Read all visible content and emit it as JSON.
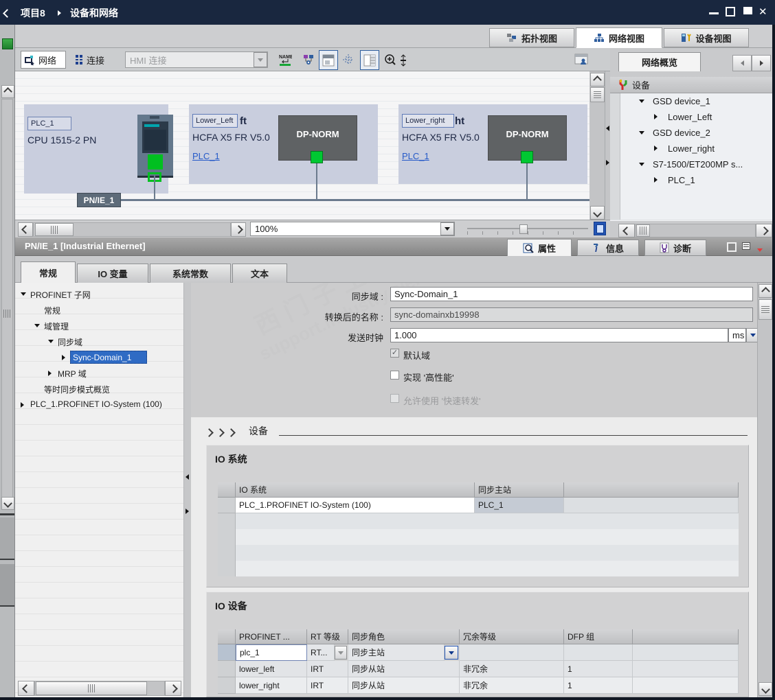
{
  "colors": {
    "titlebar_bg": "#19273f",
    "selection_blue": "#2f6bc4",
    "link_blue": "#2559c8",
    "status_green": "#00c832",
    "dpnorm_gray": "#5f6264",
    "device_lavender": "#c9cede",
    "bus_slate": "#6b7a8d"
  },
  "titlebar": {
    "project": "项目8",
    "page": "设备和网络"
  },
  "view_tabs": {
    "topology": "拓扑视图",
    "network": "网络视图",
    "device": "设备视图"
  },
  "toolbar": {
    "network": "网络",
    "connections": "连接",
    "hmi_connection": "HMI 连接"
  },
  "canvas": {
    "plc": {
      "name": "PLC_1",
      "model": "CPU 1515-2 PN"
    },
    "left": {
      "name": "Lower_Left",
      "tail": "ft",
      "model": "HCFA X5 FR V5.0",
      "link": "PLC_1",
      "badge": "DP-NORM"
    },
    "right": {
      "name": "Lower_right",
      "tail": "ht",
      "model": "HCFA X5 FR V5.0",
      "link": "PLC_1",
      "badge": "DP-NORM"
    },
    "bus": "PN/IE_1",
    "zoom": "100%"
  },
  "overview": {
    "tab": "网络概览",
    "device_col": "设备",
    "rows": [
      {
        "label": "GSD device_1"
      },
      {
        "label": "Lower_Left"
      },
      {
        "label": "GSD device_2"
      },
      {
        "label": "Lower_right"
      },
      {
        "label": "S7-1500/ET200MP s..."
      },
      {
        "label": "PLC_1"
      }
    ]
  },
  "props": {
    "title": "PN/IE_1 [Industrial Ethernet]",
    "tabs": {
      "properties": "属性",
      "info": "信息",
      "diagnostics": "诊断"
    },
    "subtabs": {
      "general": "常规",
      "io_tags": "IO 变量",
      "system_constants": "系统常数",
      "texts": "文本"
    },
    "tree": {
      "profinet_subnet": "PROFINET 子网",
      "general": "常规",
      "domain_management": "域管理",
      "sync_domain": "同步域",
      "sync_domain_1": "Sync-Domain_1",
      "mrp_domain": "MRP 域",
      "isochronous_overview": "等时同步模式概览",
      "io_system": "PLC_1.PROFINET IO-System (100)"
    },
    "form": {
      "sync_domain_label": "同步域 :",
      "sync_domain_value": "Sync-Domain_1",
      "converted_name_label": "转换后的名称 :",
      "converted_name_value": "sync-domainxb19998",
      "send_clock_label": "发送时钟",
      "send_clock_value": "1.000",
      "send_clock_unit": "ms",
      "default_domain_label": "默认域",
      "high_performance_label": "实现 '高性能'",
      "fast_forwarding_label": "允许使用 '快速转发'"
    },
    "devices_section": "设备",
    "io_system": {
      "heading": "IO 系统",
      "col_system": "IO 系统",
      "col_master": "同步主站",
      "rows": [
        {
          "system": "PLC_1.PROFINET IO-System (100)",
          "master": "PLC_1"
        }
      ]
    },
    "io_devices": {
      "heading": "IO 设备",
      "col_name": "PROFINET ...",
      "col_rt": "RT 等级",
      "col_role": "同步角色",
      "col_redundancy": "冗余等级",
      "col_dfp": "DFP 组",
      "rows": [
        {
          "name": "plc_1",
          "rt": "RT...",
          "role": "同步主站",
          "redundancy": "",
          "dfp": ""
        },
        {
          "name": "lower_left",
          "rt": "IRT",
          "role": "同步从站",
          "redundancy": "非冗余",
          "dfp": "1"
        },
        {
          "name": "lower_right",
          "rt": "IRT",
          "role": "同步从站",
          "redundancy": "非冗余",
          "dfp": "1"
        }
      ]
    }
  },
  "watermark": {
    "line1": "西门子工业 找答案",
    "line2": "support.industry.siemens.com/cs"
  }
}
